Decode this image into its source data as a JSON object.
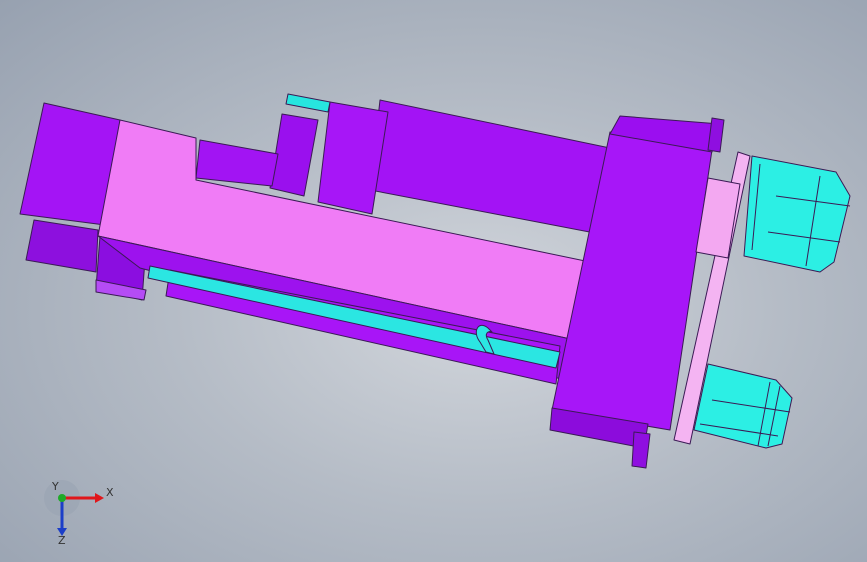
{
  "viewport": {
    "background_color": "#a9b1bd"
  },
  "model": {
    "colors": {
      "purple_dark": "#9b0ef0",
      "purple_mid": "#a514f7",
      "purple_light": "#b03dfa",
      "pink": "#f17cf6",
      "pink_light": "#f6b0f4",
      "cyan": "#27f0e6",
      "cyan_light": "#2fd8d4",
      "outline": "#3b1a55"
    }
  },
  "triad": {
    "x_label": "X",
    "y_label": "Y",
    "z_label": "Z",
    "x_color": "#e0161b",
    "y_color": "#1faa28",
    "z_color": "#1b3ec8"
  }
}
